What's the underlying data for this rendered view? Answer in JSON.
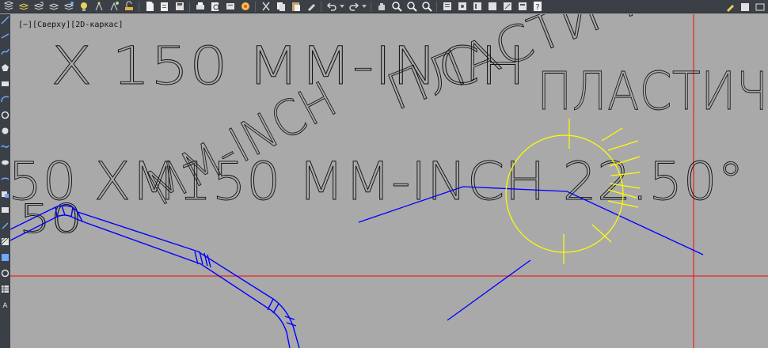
{
  "toolbar": {
    "icons": [
      "new-icon",
      "open-icon",
      "save-icon",
      "saveas-icon",
      "plot-icon",
      "preview-icon",
      "publish-icon",
      "render-icon",
      "cut-icon",
      "copy-icon",
      "paste-icon",
      "matchprop-icon",
      "undo-icon",
      "redo-icon",
      "pan-icon",
      "zoom-realtime-icon",
      "zoom-window-icon",
      "zoom-previous-icon",
      "properties-icon",
      "help-icon"
    ],
    "colors": {
      "bg": "#3b3f46",
      "icon": "#d8d8d8"
    }
  },
  "viewport": {
    "label_minus": "[−]",
    "label_view": "[Сверху]",
    "label_style": "[2D-каркас]"
  },
  "drawing": {
    "text_line1": "X 150 MM-INCH",
    "text_line1b": "ПЛАСТИЧ",
    "text_rotated1": "MM-INCH",
    "text_rotated2": "ПЛАСТИЧ",
    "text_line2": "50 XM150 MM-INCH 22.50°",
    "text_line3": "50",
    "colors": {
      "background": "#a9a9a9",
      "text": "#111111",
      "pipe": "#0000ff",
      "crosshair": "#ff0000",
      "marker": "#ffff00"
    }
  }
}
